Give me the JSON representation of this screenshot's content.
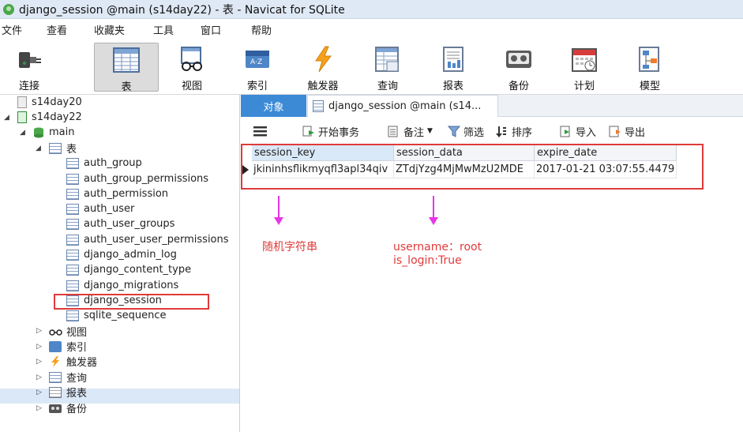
{
  "window": {
    "title": "django_session @main (s14day22) - 表 - Navicat for SQLite"
  },
  "menu": [
    "文件",
    "查看",
    "收藏夹",
    "工具",
    "窗口",
    "帮助"
  ],
  "toolbar": [
    {
      "label": "连接",
      "icon": "plug-icon"
    },
    {
      "label": "表",
      "icon": "table-icon"
    },
    {
      "label": "视图",
      "icon": "glasses-icon"
    },
    {
      "label": "索引",
      "icon": "index-icon"
    },
    {
      "label": "触发器",
      "icon": "lightning-icon"
    },
    {
      "label": "查询",
      "icon": "query-icon"
    },
    {
      "label": "报表",
      "icon": "report-icon"
    },
    {
      "label": "备份",
      "icon": "backup-icon"
    },
    {
      "label": "计划",
      "icon": "calendar-icon"
    },
    {
      "label": "模型",
      "icon": "model-icon"
    }
  ],
  "sidebar": {
    "connections": [
      "s14day20",
      "s14day22"
    ],
    "database": "main",
    "tables_label": "表",
    "tables": [
      "auth_group",
      "auth_group_permissions",
      "auth_permission",
      "auth_user",
      "auth_user_groups",
      "auth_user_user_permissions",
      "django_admin_log",
      "django_content_type",
      "django_migrations",
      "django_session",
      "sqlite_sequence"
    ],
    "selected": "django_session",
    "groups": [
      "视图",
      "索引",
      "触发器",
      "查询",
      "报表",
      "备份"
    ]
  },
  "tabs": {
    "objects": "对象",
    "document": "django_session @main (s14..."
  },
  "subtoolbar": {
    "begin_tx": "开始事务",
    "memo": "备注",
    "filter": "筛选",
    "sort": "排序",
    "import": "导入",
    "export": "导出"
  },
  "table": {
    "columns": [
      "session_key",
      "session_data",
      "expire_date"
    ],
    "rows": [
      [
        "jkininhsflikmyqfl3apl34qiv",
        "ZTdjYzg4MjMwMzU2MDE",
        "2017-01-21 03:07:55.4479"
      ]
    ]
  },
  "annotations": {
    "left": "随机字符串",
    "right_line1": "username：root",
    "right_line2": "is_login:True"
  },
  "colors": {
    "accent": "#3c8ad6",
    "highlight": "#e03a3a",
    "arrow": "#e636e6"
  }
}
